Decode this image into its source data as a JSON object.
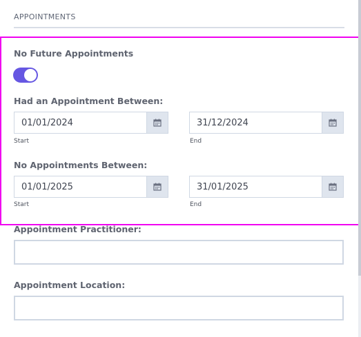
{
  "section": {
    "title": "APPOINTMENTS"
  },
  "no_future": {
    "label": "No Future Appointments",
    "toggle_on": true
  },
  "had_between": {
    "label": "Had an Appointment Between:",
    "start": {
      "value": "01/01/2024",
      "label": "Start"
    },
    "end": {
      "value": "31/12/2024",
      "label": "End"
    }
  },
  "no_between": {
    "label": "No Appointments Between:",
    "start": {
      "value": "01/01/2025",
      "label": "Start"
    },
    "end": {
      "value": "31/01/2025",
      "label": "End"
    }
  },
  "practitioner": {
    "label": "Appointment Practitioner:",
    "value": ""
  },
  "location": {
    "label": "Appointment Location:",
    "value": ""
  },
  "colors": {
    "accent": "#6657e2",
    "highlight": "#f000f0",
    "border": "#cfd7e3"
  },
  "icons": {
    "calendar": "calendar-icon"
  }
}
